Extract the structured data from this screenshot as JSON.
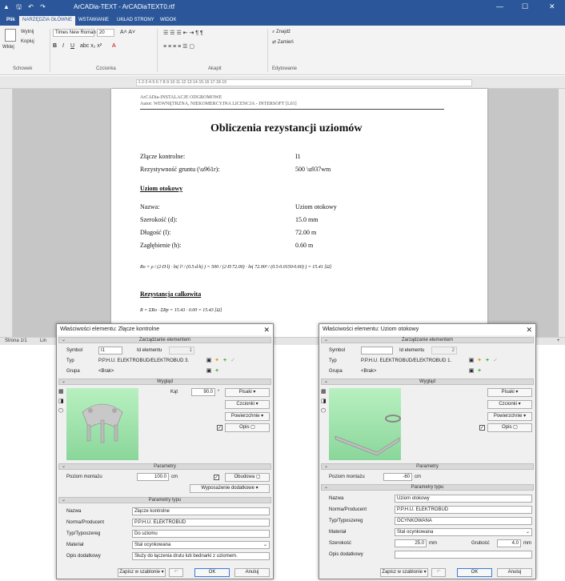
{
  "window": {
    "title": "ArCADia-TEXT - ArCADiaTEXT0.rtf",
    "minimize": "—",
    "maximize": "☐",
    "close": "✕"
  },
  "ribbon": {
    "tabs": [
      "Plik",
      "NARZĘDZIA GŁÓWNE",
      "WSTAWIANIE",
      "UKŁAD STRONY",
      "WIDOK"
    ],
    "clipboard": {
      "paste": "Wklej",
      "cut": "Wytnij",
      "copy": "Kopiuj",
      "group": "Schowek"
    },
    "font": {
      "name": "Times New Roman",
      "size": "20",
      "group": "Czcionka"
    },
    "paragraph": {
      "group": "Akapit"
    },
    "editing": {
      "find": "Znajdź",
      "replace": "Zamień",
      "group": "Edytowanie"
    }
  },
  "ruler": {
    "marks": "·1·2·3·4·5·6·7·8·9·10·11·12·13·14·15·16·17·18·19"
  },
  "status": {
    "page": "Strona 1/1",
    "line": "Lin",
    "zoom_plus": "+"
  },
  "document": {
    "header_line1": "ArCADia-INSTALACJE ODGROMOWE",
    "header_line2": "Autor: WEWNĘTRZNA, NIEKOMERCYJNA LICENCJA - INTERSOFT [L01]",
    "title": "Obliczenia rezystancji uziomów",
    "rows1": [
      {
        "label": "Złącze kontrolne:",
        "value": "I1"
      },
      {
        "label": "Rezystywność gruntu (\\u961r):",
        "value": "500 \\u937wm"
      }
    ],
    "section1": "Uziom otokowy",
    "rows2": [
      {
        "label": "Nazwa:",
        "value": "Uziom otokowy"
      },
      {
        "label": "Szerokość (d):",
        "value": "15.0 mm"
      },
      {
        "label": "Długość (l):",
        "value": "72.00 m"
      },
      {
        "label": "Zagłębienie (h):",
        "value": "0.60 m"
      }
    ],
    "formula1": "Ro = ρ / (2·Π·l) · ln( l² / (0.5·d·h) ) = 500 / (2·Π·72.00) · ln( 72.00² / (0.5·0.0150·0.60) ) = 15.41 [Ω]",
    "section2": "Rezystancja całkowita",
    "formula2": "R = ΣRo · ΣRp = 15.43 · 0.00 = 15.43 [Ω]"
  },
  "dialog1": {
    "title": "Właściwości elementu: Złącze kontrolne",
    "sec_management": "Zarządzanie elementem",
    "symbol_label": "Symbol",
    "symbol": "I1",
    "id_label": "Id elementu",
    "id": "1",
    "type_label": "Typ",
    "type": "P.P.H.U. ELEKTROBUD/ELEKTROBUD 3.",
    "group_label": "Grupa",
    "group": "<Brak>",
    "sec_view": "Wygląd",
    "angle_label": "Kąt",
    "angle": "90.0",
    "angle_unit": "°",
    "pens": "Pisaki",
    "fonts": "Czcionki",
    "surfaces": "Powierzchnie",
    "desc": "Opis",
    "sec_params": "Parametry",
    "mount_label": "Poziom montażu",
    "mount": "100.0",
    "mount_unit": "cm",
    "housing": "Obudowa",
    "equipment": "Wyposażenie dodatkowe",
    "sec_type_params": "Parametry typu",
    "name_label": "Nazwa",
    "name": "Złącze kontrolne",
    "norm_label": "Norma/Producent",
    "norm": "P.P.H.U. ELEKTROBUD",
    "typ_label": "Typ/Typoszereg",
    "typ": "Do uziomu",
    "material_label": "Materiał",
    "material": "Stal ocynkowana",
    "extra_label": "Opis dodatkowy",
    "extra": "Służy do łączenia drutu lub bednarki z uziomem.",
    "save_template": "Zapisz w szablonie",
    "ok": "OK",
    "cancel": "Anuluj"
  },
  "dialog2": {
    "title": "Właściwości elementu: Uziom otokowy",
    "sec_management": "Zarządzanie elementem",
    "symbol_label": "Symbol",
    "symbol": "",
    "id_label": "Id elementu",
    "id": "2",
    "type_label": "Typ",
    "type": "P.P.H.U. ELEKTROBUD/ELEKTROBUD 1.",
    "group_label": "Grupa",
    "group": "<Brak>",
    "sec_view": "Wygląd",
    "pens": "Pisaki",
    "fonts": "Czcionki",
    "surfaces": "Powierzchnie",
    "desc": "Opis",
    "sec_params": "Parametry",
    "mount_label": "Poziom montażu",
    "mount": "-60",
    "mount_unit": "cm",
    "sec_type_params": "Parametry typu",
    "name_label": "Nazwa",
    "name": "Uziom otokowy",
    "norm_label": "Norma/Producent",
    "norm": "P.P.H.U. ELEKTROBUD",
    "typ_label": "Typ/Typoszereg",
    "typ": "OCYNKOWANA",
    "material_label": "Materiał",
    "material": "Stal ocynkowana",
    "width_label": "Szerokość",
    "width": "25.0",
    "width_unit": "mm",
    "thickness_label": "Grubość",
    "thickness": "4.0",
    "thickness_unit": "mm",
    "extra_label": "Opis dodatkowy",
    "extra": "",
    "save_template": "Zapisz w szablonie",
    "ok": "OK",
    "cancel": "Anuluj"
  },
  "colors": {
    "accent": "#2b579a",
    "preview_bg": "#a8e8b0"
  }
}
